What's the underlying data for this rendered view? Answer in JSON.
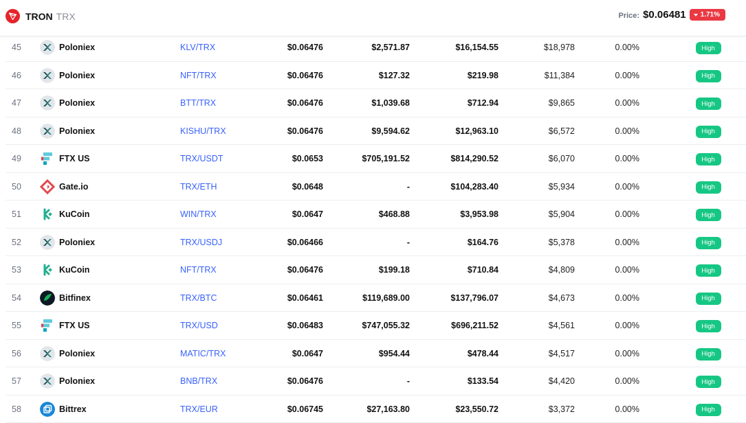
{
  "header": {
    "coin_name": "TRON",
    "coin_symbol": "TRX",
    "price_label": "Price:",
    "price_value": "$0.06481",
    "change": "1.71%",
    "colors": {
      "brand": "#e5242b",
      "negative": "#ea3943",
      "positive": "#16c784",
      "link": "#3861fb"
    }
  },
  "rows": [
    {
      "rank": "45",
      "exchange": "Poloniex",
      "icon": "poloniex-icon",
      "pair": "KLV/TRX",
      "price": "$0.06476",
      "depth_plus": "$2,571.87",
      "depth_minus": "$16,154.55",
      "volume": "$18,978",
      "volume_pct": "0.00%",
      "confidence": "High"
    },
    {
      "rank": "46",
      "exchange": "Poloniex",
      "icon": "poloniex-icon",
      "pair": "NFT/TRX",
      "price": "$0.06476",
      "depth_plus": "$127.32",
      "depth_minus": "$219.98",
      "volume": "$11,384",
      "volume_pct": "0.00%",
      "confidence": "High"
    },
    {
      "rank": "47",
      "exchange": "Poloniex",
      "icon": "poloniex-icon",
      "pair": "BTT/TRX",
      "price": "$0.06476",
      "depth_plus": "$1,039.68",
      "depth_minus": "$712.94",
      "volume": "$9,865",
      "volume_pct": "0.00%",
      "confidence": "High"
    },
    {
      "rank": "48",
      "exchange": "Poloniex",
      "icon": "poloniex-icon",
      "pair": "KISHU/TRX",
      "price": "$0.06476",
      "depth_plus": "$9,594.62",
      "depth_minus": "$12,963.10",
      "volume": "$6,572",
      "volume_pct": "0.00%",
      "confidence": "High"
    },
    {
      "rank": "49",
      "exchange": "FTX US",
      "icon": "ftx-us-icon",
      "pair": "TRX/USDT",
      "price": "$0.0653",
      "depth_plus": "$705,191.52",
      "depth_minus": "$814,290.52",
      "volume": "$6,070",
      "volume_pct": "0.00%",
      "confidence": "High"
    },
    {
      "rank": "50",
      "exchange": "Gate.io",
      "icon": "gate-io-icon",
      "pair": "TRX/ETH",
      "price": "$0.0648",
      "depth_plus": "-",
      "depth_minus": "$104,283.40",
      "volume": "$5,934",
      "volume_pct": "0.00%",
      "confidence": "High"
    },
    {
      "rank": "51",
      "exchange": "KuCoin",
      "icon": "kucoin-icon",
      "pair": "WIN/TRX",
      "price": "$0.0647",
      "depth_plus": "$468.88",
      "depth_minus": "$3,953.98",
      "volume": "$5,904",
      "volume_pct": "0.00%",
      "confidence": "High"
    },
    {
      "rank": "52",
      "exchange": "Poloniex",
      "icon": "poloniex-icon",
      "pair": "TRX/USDJ",
      "price": "$0.06466",
      "depth_plus": "-",
      "depth_minus": "$164.76",
      "volume": "$5,378",
      "volume_pct": "0.00%",
      "confidence": "High"
    },
    {
      "rank": "53",
      "exchange": "KuCoin",
      "icon": "kucoin-icon",
      "pair": "NFT/TRX",
      "price": "$0.06476",
      "depth_plus": "$199.18",
      "depth_minus": "$710.84",
      "volume": "$4,809",
      "volume_pct": "0.00%",
      "confidence": "High"
    },
    {
      "rank": "54",
      "exchange": "Bitfinex",
      "icon": "bitfinex-icon",
      "pair": "TRX/BTC",
      "price": "$0.06461",
      "depth_plus": "$119,689.00",
      "depth_minus": "$137,796.07",
      "volume": "$4,673",
      "volume_pct": "0.00%",
      "confidence": "High"
    },
    {
      "rank": "55",
      "exchange": "FTX US",
      "icon": "ftx-us-icon",
      "pair": "TRX/USD",
      "price": "$0.06483",
      "depth_plus": "$747,055.32",
      "depth_minus": "$696,211.52",
      "volume": "$4,561",
      "volume_pct": "0.00%",
      "confidence": "High"
    },
    {
      "rank": "56",
      "exchange": "Poloniex",
      "icon": "poloniex-icon",
      "pair": "MATIC/TRX",
      "price": "$0.0647",
      "depth_plus": "$954.44",
      "depth_minus": "$478.44",
      "volume": "$4,517",
      "volume_pct": "0.00%",
      "confidence": "High"
    },
    {
      "rank": "57",
      "exchange": "Poloniex",
      "icon": "poloniex-icon",
      "pair": "BNB/TRX",
      "price": "$0.06476",
      "depth_plus": "-",
      "depth_minus": "$133.54",
      "volume": "$4,420",
      "volume_pct": "0.00%",
      "confidence": "High"
    },
    {
      "rank": "58",
      "exchange": "Bittrex",
      "icon": "bittrex-icon",
      "pair": "TRX/EUR",
      "price": "$0.06745",
      "depth_plus": "$27,163.80",
      "depth_minus": "$23,550.72",
      "volume": "$3,372",
      "volume_pct": "0.00%",
      "confidence": "High"
    }
  ]
}
